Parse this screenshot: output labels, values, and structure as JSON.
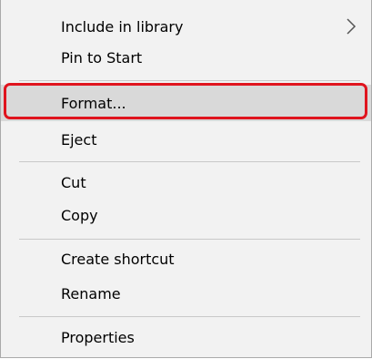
{
  "context_menu": {
    "items": [
      {
        "label": "Include in library",
        "has_submenu": true
      },
      {
        "label": "Pin to Start"
      },
      {
        "label": "Format..."
      },
      {
        "label": "Eject"
      },
      {
        "label": "Cut"
      },
      {
        "label": "Copy"
      },
      {
        "label": "Create shortcut"
      },
      {
        "label": "Rename"
      },
      {
        "label": "Properties"
      }
    ],
    "highlighted_item": "Format...",
    "highlight_color": "#d9d9d9",
    "annotation_color": "#e0141e"
  }
}
